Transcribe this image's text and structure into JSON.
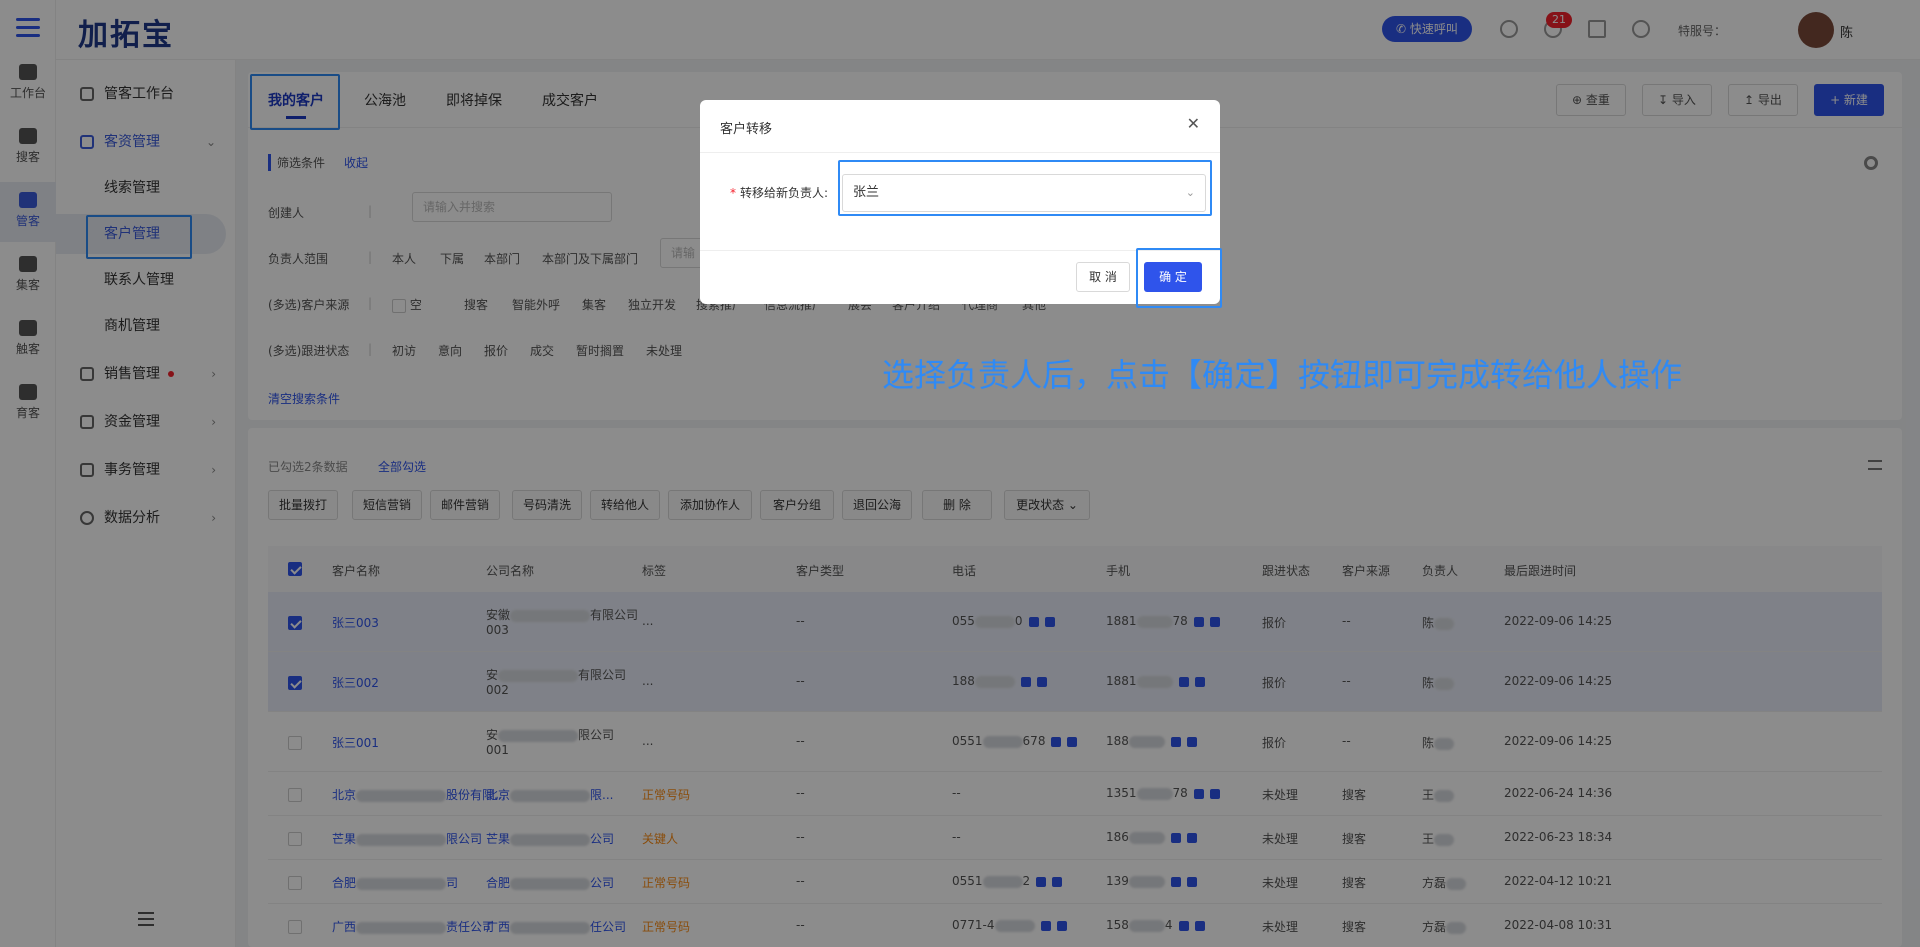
{
  "topbar": {
    "logo": "加拓宝",
    "call_label": "快速呼叫",
    "notif_count": "21",
    "ext_label": "特服号：",
    "user_name": "陈"
  },
  "rail": [
    {
      "label": "工作台"
    },
    {
      "label": "搜客"
    },
    {
      "label": "管客"
    },
    {
      "label": "集客"
    },
    {
      "label": "触客"
    },
    {
      "label": "育客"
    }
  ],
  "sidebar": {
    "workbench": "管客工作台",
    "resource": "客资管理",
    "subs": [
      "线索管理",
      "客户管理",
      "联系人管理",
      "商机管理"
    ],
    "sales": "销售管理",
    "finance": "资金管理",
    "affairs": "事务管理",
    "analytics": "数据分析"
  },
  "tabs": [
    "我的客户",
    "公海池",
    "即将掉保",
    "成交客户"
  ],
  "toolbar": {
    "dup": "查重",
    "import": "导入",
    "export": "导出",
    "create": "+ 新建"
  },
  "filters": {
    "title": "筛选条件",
    "collapse": "收起",
    "creator_label": "创建人",
    "creator_placeholder": "请输入并搜索",
    "owner_label": "负责人范围",
    "owner_opts": [
      "本人",
      "下属",
      "本部门",
      "本部门及下属部门"
    ],
    "owner_placeholder": "请输",
    "source_label": "(多选)客户来源",
    "source_opts": [
      "空",
      "搜客",
      "智能外呼",
      "集客",
      "独立开发",
      "搜索推广",
      "信息流推广",
      "展会",
      "客户介绍",
      "代理商",
      "其他"
    ],
    "status_label": "(多选)跟进状态",
    "status_opts": [
      "初访",
      "意向",
      "报价",
      "成交",
      "暂时搁置",
      "未处理"
    ],
    "clear": "清空搜索条件"
  },
  "selection": {
    "info": "已勾选2条数据",
    "select_all": "全部勾选"
  },
  "actions": [
    "批量拨打",
    "短信营销",
    "邮件营销",
    "号码清洗",
    "转给他人",
    "添加协作人",
    "客户分组",
    "退回公海",
    "删 除",
    "更改状态 ⌄"
  ],
  "columns": [
    "客户名称",
    "公司名称",
    "标签",
    "客户类型",
    "电话",
    "手机",
    "跟进状态",
    "客户来源",
    "负责人",
    "最后跟进时间"
  ],
  "rows": [
    {
      "checked": true,
      "name": "张三003",
      "company": "安徽",
      "company_suffix": "有限公司",
      "company_line2": "003",
      "tag": "...",
      "tag_orange": false,
      "type": "--",
      "tel": "055",
      "tel_tail": "0",
      "mobile": "1881",
      "mobile_tail": "78",
      "status": "报价",
      "source": "--",
      "owner": "陈",
      "time": "2022-09-06 14:25"
    },
    {
      "checked": true,
      "name": "张三002",
      "company": "安",
      "company_suffix": "有限公司",
      "company_line2": "002",
      "tag": "...",
      "tag_orange": false,
      "type": "--",
      "tel": "188",
      "tel_tail": "",
      "mobile": "1881",
      "mobile_tail": "",
      "status": "报价",
      "source": "--",
      "owner": "陈",
      "time": "2022-09-06 14:25"
    },
    {
      "checked": false,
      "name": "张三001",
      "company": "安",
      "company_suffix": "限公司",
      "company_line2": "001",
      "tag": "...",
      "tag_orange": false,
      "type": "--",
      "tel": "0551",
      "tel_tail": "678",
      "mobile": "188",
      "mobile_tail": "",
      "status": "报价",
      "source": "--",
      "owner": "陈",
      "time": "2022-09-06 14:25"
    },
    {
      "checked": false,
      "name": "北京",
      "company": "北京",
      "company_suffix": "限...",
      "company_line2": "",
      "name_suffix": "股份有限...",
      "tag": "正常号码",
      "tag_orange": true,
      "type": "--",
      "tel": "--",
      "tel_tail": "",
      "mobile": "1351",
      "mobile_tail": "78",
      "status": "未处理",
      "source": "搜客",
      "owner": "王",
      "time": "2022-06-24 14:36"
    },
    {
      "checked": false,
      "name": "芒果",
      "company": "芒果",
      "company_suffix": "公司",
      "company_line2": "",
      "name_suffix": "限公司",
      "tag": "关键人",
      "tag_orange": true,
      "type": "--",
      "tel": "--",
      "tel_tail": "",
      "mobile": "186",
      "mobile_tail": "",
      "status": "未处理",
      "source": "搜客",
      "owner": "王",
      "time": "2022-06-23 18:34"
    },
    {
      "checked": false,
      "name": "合肥",
      "company": "合肥",
      "company_suffix": "公司",
      "company_line2": "",
      "name_suffix": "司",
      "tag": "正常号码",
      "tag_orange": true,
      "type": "--",
      "tel": "0551",
      "tel_tail": "2",
      "mobile": "139",
      "mobile_tail": "",
      "status": "未处理",
      "source": "搜客",
      "owner": "方磊",
      "time": "2022-04-12 10:21"
    },
    {
      "checked": false,
      "name": "广西",
      "company": "广西",
      "company_suffix": "任公司",
      "company_line2": "",
      "name_suffix": "责任公司",
      "tag": "正常号码",
      "tag_orange": true,
      "type": "--",
      "tel": "0771-4",
      "tel_tail": "",
      "mobile": "158",
      "mobile_tail": "4",
      "status": "未处理",
      "source": "搜客",
      "owner": "方磊",
      "time": "2022-04-08 10:31"
    }
  ],
  "modal": {
    "title": "客户转移",
    "label": "转移给新负责人:",
    "value": "张兰",
    "cancel": "取 消",
    "ok": "确 定"
  },
  "annotation": "选择负责人后，点击【确定】按钮即可完成转给他人操作"
}
